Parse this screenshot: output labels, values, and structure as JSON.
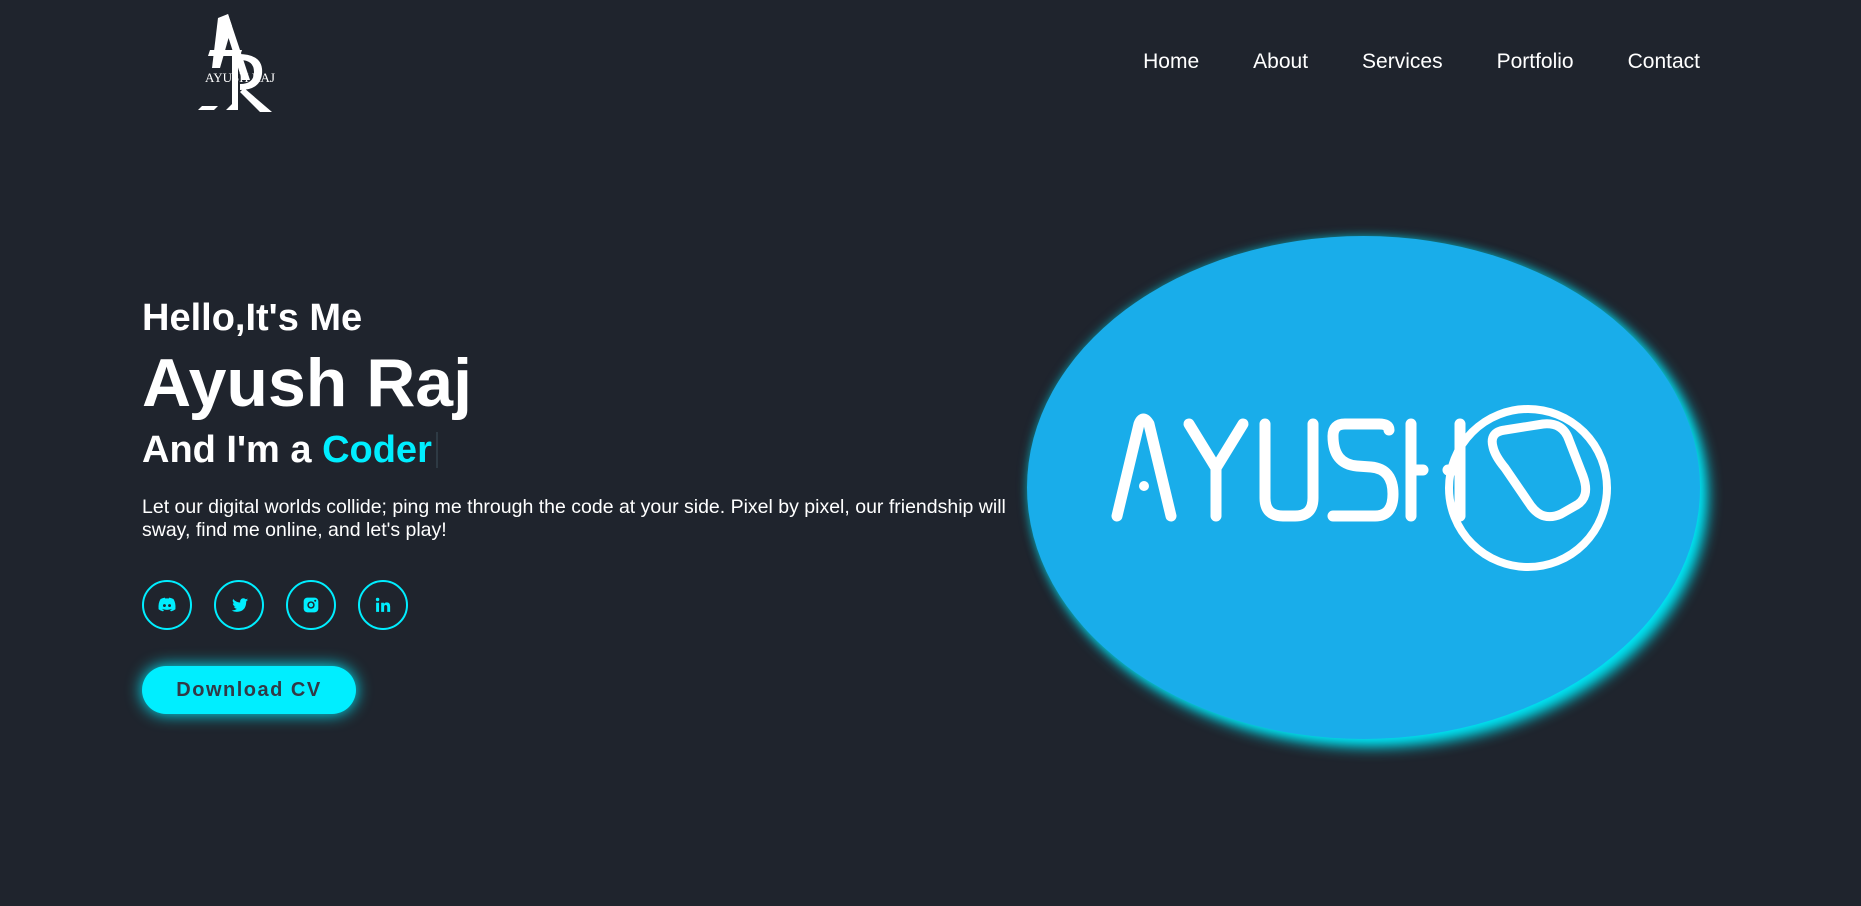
{
  "header": {
    "logo": {
      "text": "AYUSH RAJ",
      "icon": "ar-monogram-logo"
    },
    "nav": [
      "Home",
      "About",
      "Services",
      "Portfolio",
      "Contact"
    ]
  },
  "hero": {
    "greeting": "Hello,It's Me",
    "name": "Ayush Raj",
    "role_prefix": "And I'm a ",
    "role_highlight": "Coder",
    "description": "Let our digital worlds collide; ping me through the code at your side. Pixel by pixel, our friendship will sway, find me online, and let's play!",
    "socials": [
      {
        "icon": "discord-icon"
      },
      {
        "icon": "twitter-icon"
      },
      {
        "icon": "instagram-icon"
      },
      {
        "icon": "linkedin-icon"
      }
    ],
    "cv_button": "Download CV",
    "image": {
      "text": "AYUSH",
      "icon": "ayush-brand-logo"
    }
  },
  "colors": {
    "background": "#1f242d",
    "accent": "#00eeff",
    "image_bg": "#19adea",
    "text": "#ffffff"
  }
}
